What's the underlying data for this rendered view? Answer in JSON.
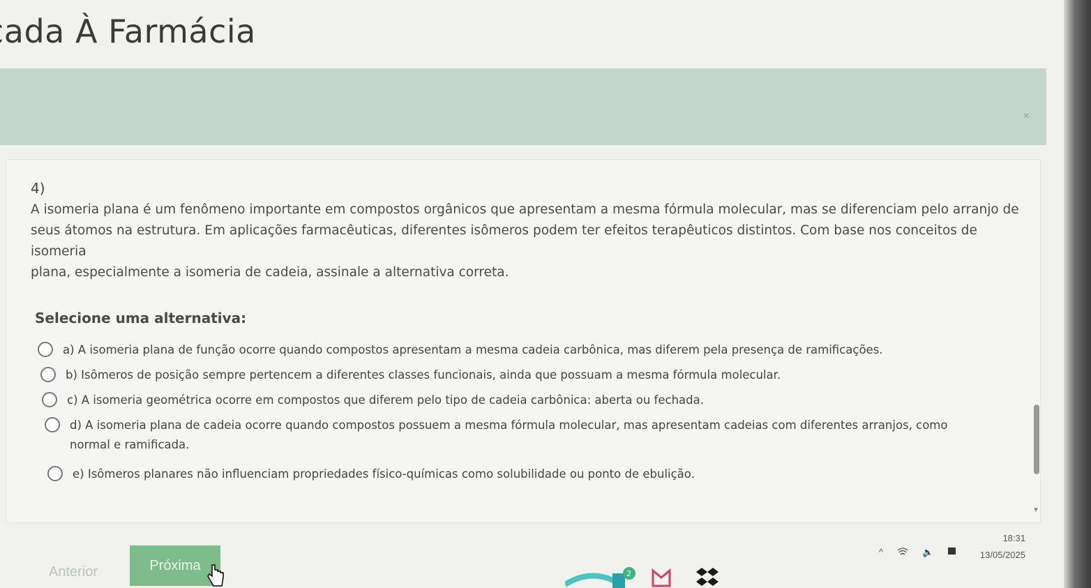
{
  "header": {
    "title": "cada À Farmácia"
  },
  "banner": {
    "close_symbol": "×"
  },
  "question": {
    "number": "4)",
    "text_lines": [
      "A isomeria plana é um fenômeno importante em compostos orgânicos que apresentam a mesma fórmula molecular, mas se diferenciam pelo arranjo de",
      "seus átomos na estrutura. Em aplicações farmacêuticas, diferentes isômeros podem ter efeitos terapêuticos distintos. Com base nos conceitos de isomeria",
      "plana, especialmente a isomeria de cadeia, assinale a alternativa correta."
    ],
    "select_label": "Selecione uma alternativa:",
    "options": [
      {
        "text": "a) A isomeria plana de função ocorre quando compostos apresentam a mesma cadeia carbônica, mas diferem pela presença de ramificações."
      },
      {
        "text": "b) Isômeros de posição sempre pertencem a diferentes classes funcionais, ainda que possuam a mesma fórmula molecular."
      },
      {
        "text": "c) A isomeria geométrica ocorre em compostos que diferem pelo tipo de cadeia carbônica: aberta ou fechada."
      },
      {
        "text": "d) A isomeria plana de cadeia ocorre quando compostos possuem a mesma fórmula molecular, mas apresentam cadeias com diferentes arranjos, como",
        "text2": "normal e ramificada."
      },
      {
        "text": "e) Isômeros planares não influenciam propriedades físico-químicas como solubilidade ou ponto de ebulição."
      }
    ]
  },
  "nav": {
    "prev_label": "Anterior",
    "next_label": "Próxima"
  },
  "system": {
    "time": "18:31",
    "date": "13/05/2025",
    "badge": "2"
  }
}
